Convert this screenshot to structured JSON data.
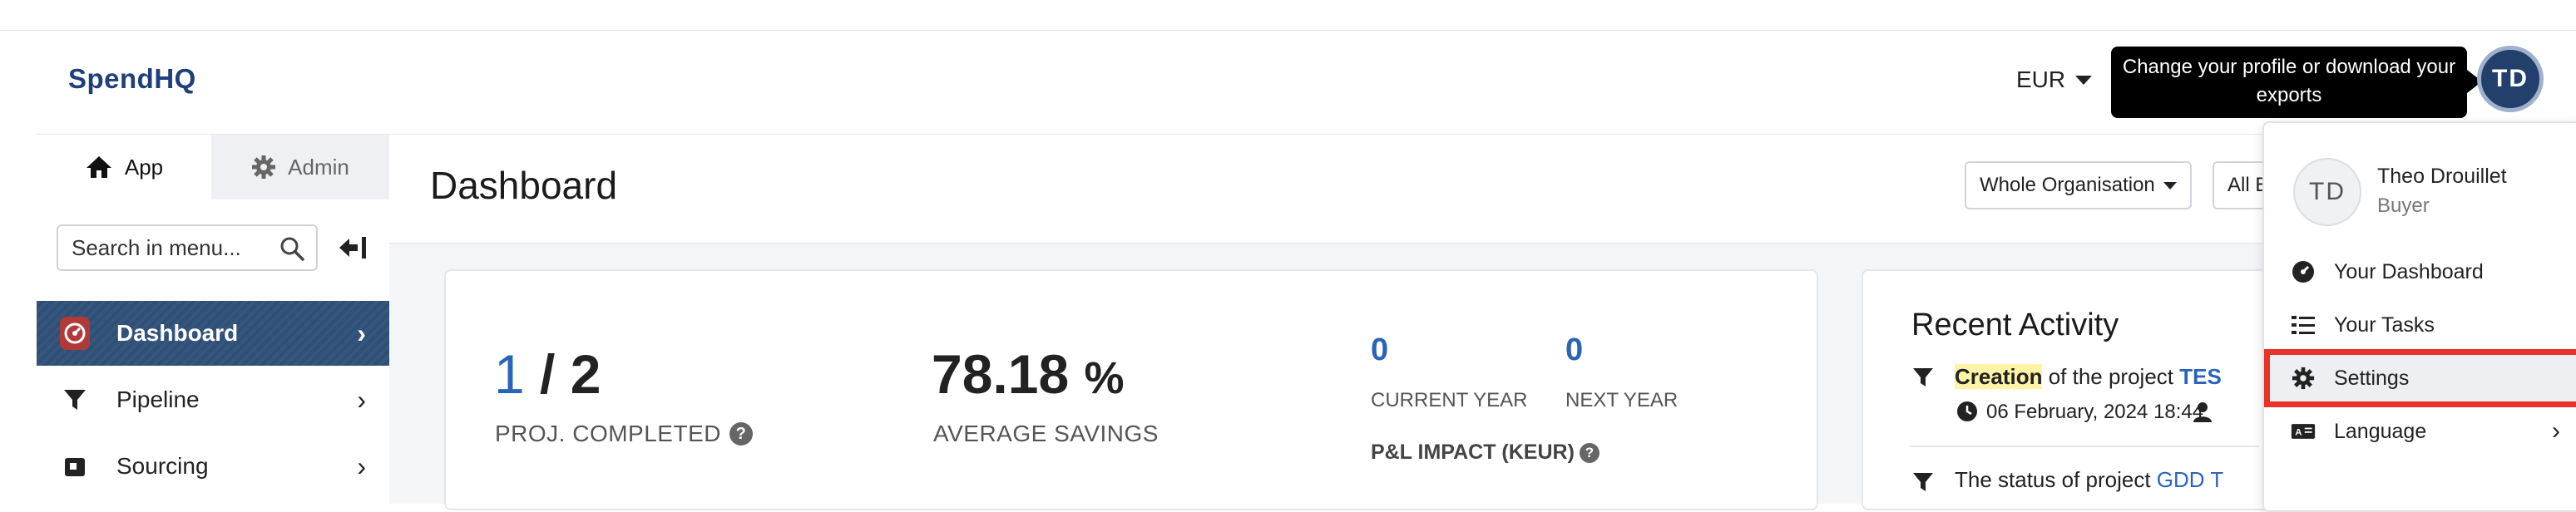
{
  "header": {
    "logo_text": "SpendHQ",
    "currency": "EUR",
    "tooltip": "Change your profile or download your exports",
    "avatar_initials": "TD"
  },
  "sidebar": {
    "tabs": [
      {
        "label": "App",
        "icon": "home-icon"
      },
      {
        "label": "Admin",
        "icon": "gear-icon"
      }
    ],
    "search_placeholder": "Search in menu...",
    "items": [
      {
        "label": "Dashboard",
        "icon": "dashboard-gauge-icon",
        "active": true
      },
      {
        "label": "Pipeline",
        "icon": "filter-icon",
        "active": false
      },
      {
        "label": "Sourcing",
        "icon": "sourcing-icon",
        "active": false
      }
    ]
  },
  "main": {
    "title": "Dashboard",
    "filters": [
      "Whole Organisation",
      "All E"
    ],
    "kpis": {
      "completed_done": "1",
      "completed_sep": " / ",
      "completed_total": "2",
      "completed_label": "PROJ. COMPLETED",
      "savings_value": "78.18",
      "savings_unit": "%",
      "savings_label": "AVERAGE SAVINGS",
      "current_year_value": "0",
      "current_year_label": "CURRENT YEAR",
      "next_year_value": "0",
      "next_year_label": "NEXT YEAR",
      "pl_label": "P&L IMPACT (KEUR)"
    },
    "recent": {
      "title": "Recent Activity",
      "entry1_highlight": "Creation",
      "entry1_text": " of the project ",
      "entry1_project": "TES",
      "entry1_date": "06 February, 2024 18:44",
      "entry2_text": "The status of project ",
      "entry2_project": "GDD T"
    }
  },
  "dropdown": {
    "initials": "TD",
    "name": "Theo Drouillet",
    "role": "Buyer",
    "items": [
      {
        "label": "Your Dashboard",
        "icon": "dashboard-gauge-icon"
      },
      {
        "label": "Your Tasks",
        "icon": "tasks-list-icon"
      },
      {
        "label": "Settings",
        "icon": "gear-icon"
      },
      {
        "label": "Language",
        "icon": "language-icon"
      }
    ]
  },
  "colors": {
    "brand": "#1f3f7a",
    "active_menu": "#2f4f77",
    "highlight_box": "#e8332a",
    "accent_blue": "#2a64b8"
  }
}
